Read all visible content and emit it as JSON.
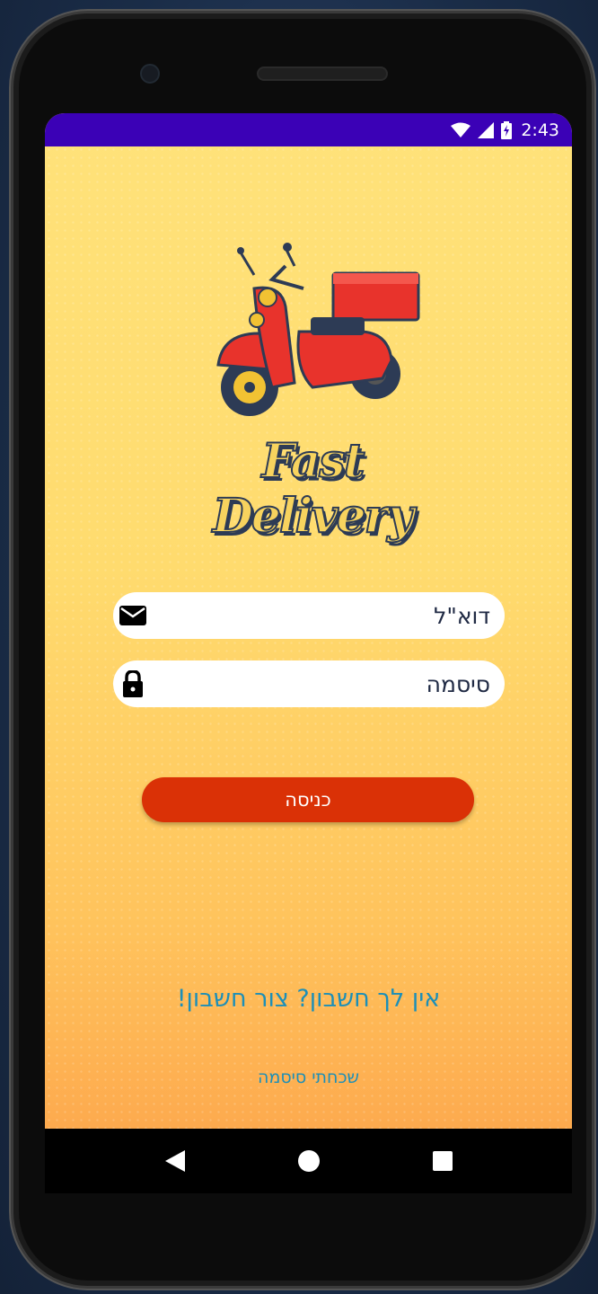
{
  "status_bar": {
    "time": "2:43",
    "icons": [
      "wifi-icon",
      "signal-icon",
      "battery-charging-icon"
    ]
  },
  "logo": {
    "text": "Fast Delivery",
    "colors": {
      "scooter": "#e8332c",
      "box": "#e8332c",
      "text": "#f7d35e",
      "outline": "#2d3b55"
    }
  },
  "login_form": {
    "email_placeholder": "דוא\"ל",
    "email_icon": "envelope-icon",
    "password_placeholder": "סיסמה",
    "password_icon": "lock-icon",
    "login_label": "כניסה"
  },
  "links": {
    "signup": "אין לך חשבון? צור חשבון!",
    "forgot_password": "שכחתי סיסמה"
  },
  "nav": {
    "back": "back-icon",
    "home": "home-icon",
    "recents": "recents-icon"
  },
  "colors": {
    "status_bar": "#3b01b6",
    "background_top": "#ffe27a",
    "background_bottom": "#fdaa4e",
    "button": "#da3106",
    "link": "#1c8fb8"
  }
}
